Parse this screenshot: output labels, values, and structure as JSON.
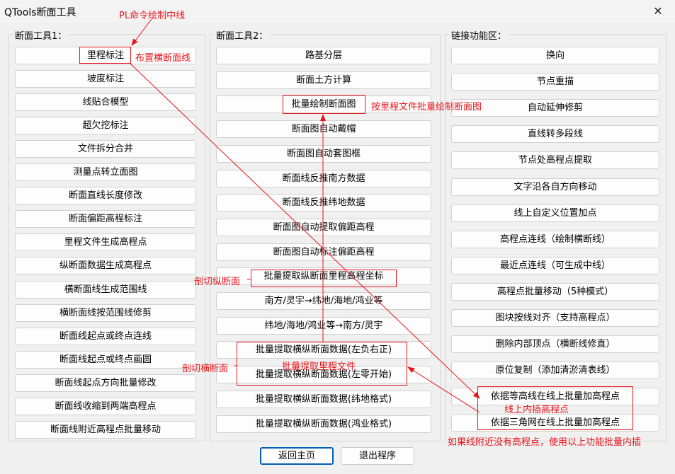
{
  "window": {
    "title": "QTools断面工具",
    "close_symbol": "✕"
  },
  "groups": {
    "g1": {
      "title": "断面工具1：",
      "buttons": [
        "里程标注",
        "坡度标注",
        "线贴合模型",
        "超欠挖标注",
        "文件拆分合并",
        "测量点转立面图",
        "断面直线长度修改",
        "断面偏距高程标注",
        "里程文件生成高程点",
        "纵断面数据生成高程点",
        "横断面线生成范围线",
        "横断面线按范围线修剪",
        "断面线起点或终点连线",
        "断面线起点或终点画圆",
        "断面线起点方向批量修改",
        "断面线收缩到两端高程点",
        "断面线附近高程点批量移动"
      ]
    },
    "g2": {
      "title": "断面工具2：",
      "buttons": [
        "路基分层",
        "断面土方计算",
        "批量绘制断面图",
        "断面图自动戴帽",
        "断面图自动套图框",
        "断面线反推南方数据",
        "断面线反推纬地数据",
        "断面图自动提取偏距高程",
        "断面图自动标注偏距高程",
        "批量提取纵断面里程高程坐标",
        "南方/灵宇→纬地/海地/鸿业等",
        "纬地/海地/鸿业等→南方/灵宇",
        "批量提取横纵断面数据(左负右正)",
        "批量提取横纵断面数据(左零开始)",
        "批量提取横纵断面数据(纬地格式)",
        "批量提取横纵断面数据(鸿业格式)"
      ]
    },
    "g3": {
      "title": "链接功能区：",
      "buttons": [
        "换向",
        "节点重描",
        "自动延伸修剪",
        "直线转多段线",
        "节点处高程点提取",
        "文字沿各自方向移动",
        "线上自定义位置加点",
        "高程点连线（绘制横断线）",
        "最近点连线（可生成中线）",
        "高程点批量移动（5种模式）",
        "图块按线对齐（支持高程点）",
        "删除内部顶点（横断线修直）",
        "原位复制（添加清淤清表线）",
        "依据等高线在线上批量加高程点",
        "依据三角网在线上批量加高程点"
      ]
    }
  },
  "bottom": {
    "home": "返回主页",
    "exit": "退出程序"
  },
  "annotations": {
    "pl_centerline": "PL命令绘制中线",
    "place_cross_lines": "布置横断面线",
    "batch_by_mileage": "按里程文件批量绘制断面图",
    "cut_longitudinal": "剖切纵断面",
    "cut_cross": "剖切横断面",
    "extract_mileage_file": "批量提取里程文件",
    "interp_on_line": "线上内插高程点",
    "no_points_hint": "如果线附近没有高程点，使用以上功能批量内插"
  },
  "colors": {
    "annotation_red": "#e8151b",
    "primary_blue": "#005fb8"
  }
}
